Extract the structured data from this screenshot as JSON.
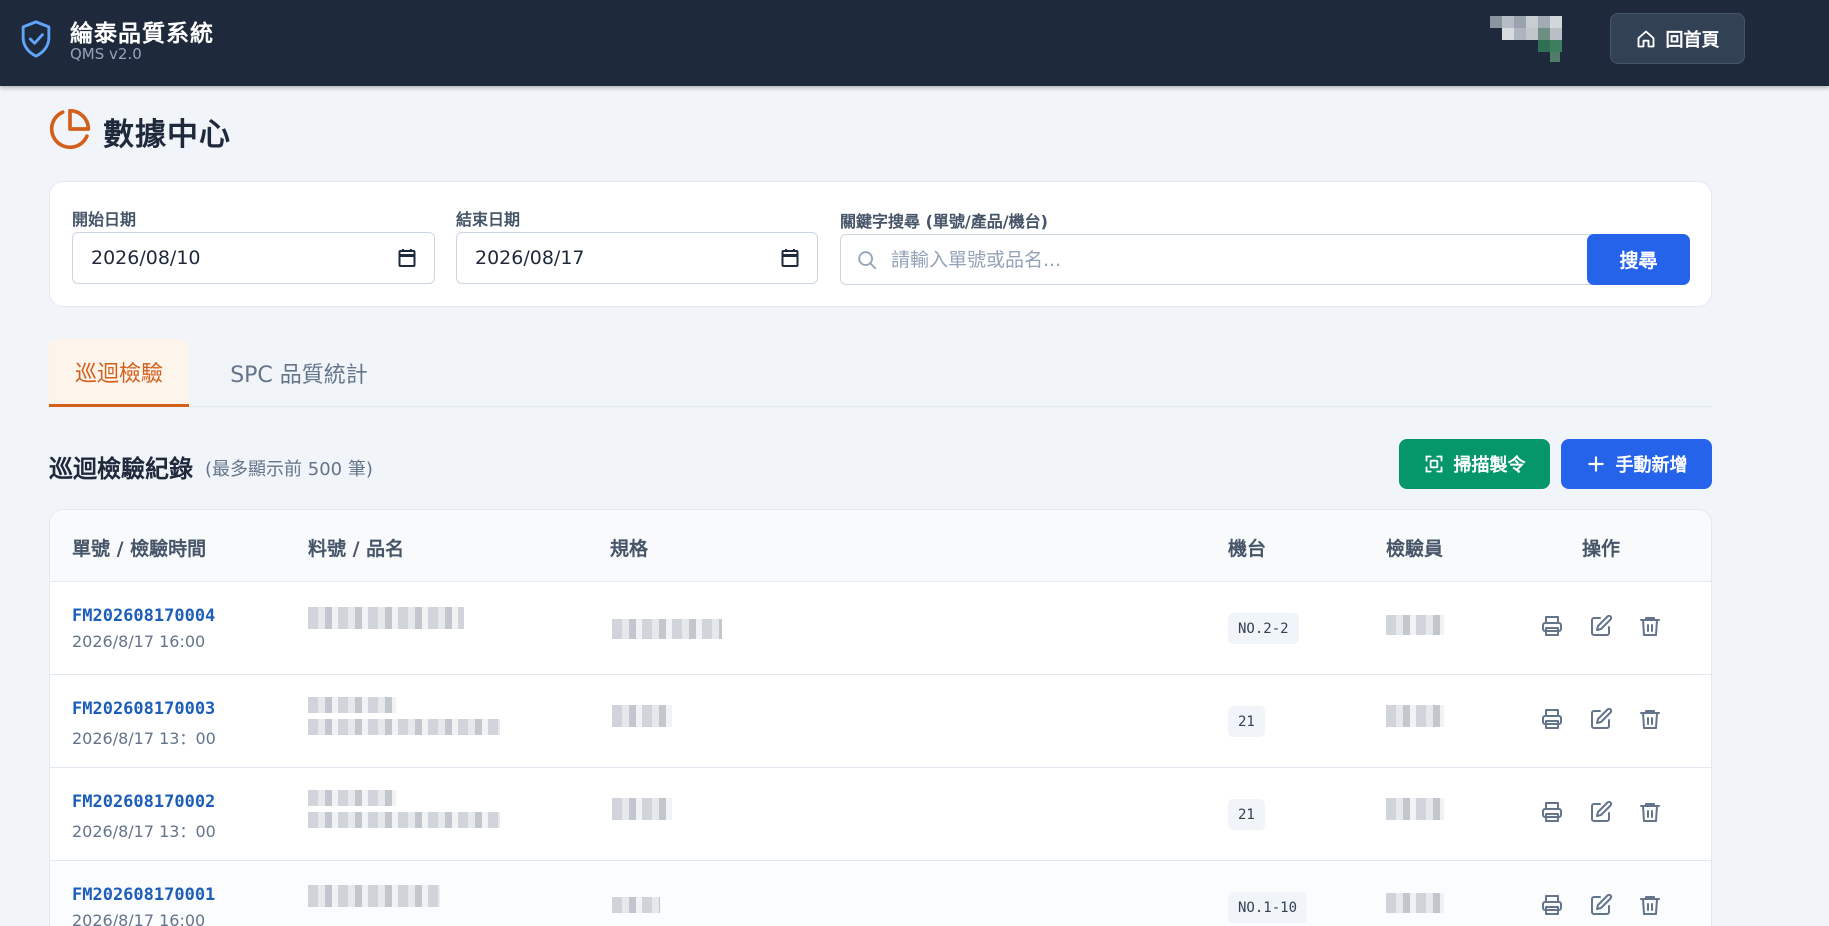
{
  "header": {
    "title": "綸泰品質系統",
    "subtitle": "QMS v2.0",
    "home_button": "回首頁"
  },
  "page": {
    "title": "數據中心"
  },
  "filters": {
    "start_label": "開始日期",
    "start_value": "2026/08/10",
    "end_label": "結束日期",
    "end_value": "2026/08/17",
    "keyword_label": "關鍵字搜尋 (單號/產品/機台)",
    "keyword_placeholder": "請輸入單號或品名...",
    "search_button": "搜尋"
  },
  "tabs": [
    {
      "label": "巡迴檢驗",
      "active": true
    },
    {
      "label": "SPC 品質統計",
      "active": false
    }
  ],
  "section": {
    "title": "巡迴檢驗紀錄",
    "note": "(最多顯示前 500 筆)",
    "scan_button": "掃描製令",
    "add_button": "手動新增"
  },
  "table": {
    "columns": [
      "單號 / 檢驗時間",
      "料號 / 品名",
      "規格",
      "機台",
      "檢驗員",
      "操作"
    ],
    "rows": [
      {
        "order_no": "FM202608170004",
        "time": "2026/8/17 16:00",
        "machine": "NO.2-2"
      },
      {
        "order_no": "FM202608170003",
        "time": "2026/8/17 13：00",
        "machine": "21"
      },
      {
        "order_no": "FM202608170002",
        "time": "2026/8/17 13：00",
        "machine": "21"
      },
      {
        "order_no": "FM202608170001",
        "time": "2026/8/17 16:00",
        "machine": "NO.1-10"
      }
    ]
  },
  "icons": {
    "brand": "shield-check-icon",
    "home": "home-icon",
    "page": "pie-chart-icon",
    "calendar": "calendar-icon",
    "search": "search-icon",
    "scan": "scan-icon",
    "add": "plus-icon",
    "print": "printer-icon",
    "edit": "edit-icon",
    "delete": "trash-icon"
  },
  "colors": {
    "header_bg": "#1e293b",
    "accent_orange": "#d2601a",
    "primary_blue": "#2563eb",
    "success_green": "#059669",
    "link_blue": "#1d5fb8"
  }
}
